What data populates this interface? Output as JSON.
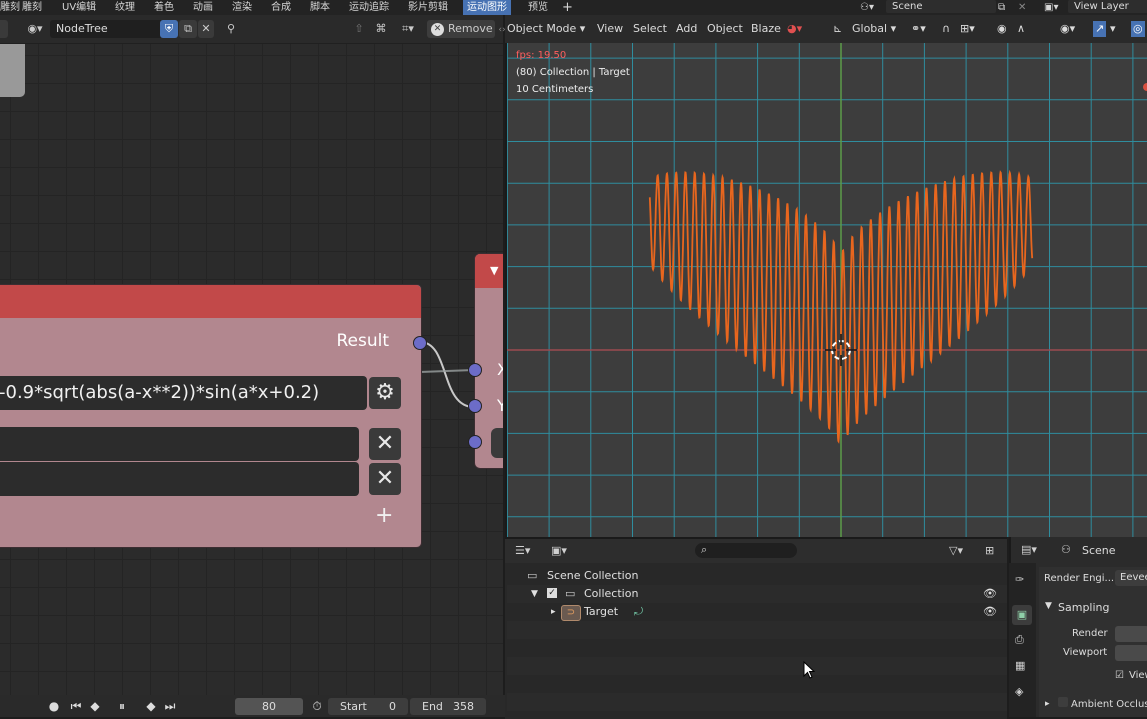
{
  "topbar": {
    "menus": [
      "雕刻",
      "UV编辑",
      "纹理",
      "着色",
      "动画",
      "渲染",
      "合成",
      "脚本",
      "运动追踪",
      "影片剪辑",
      "运动图形",
      "预览"
    ],
    "active_menu": "运动图形",
    "scene_name": "Scene",
    "view_layer": "View Layer"
  },
  "node_editor": {
    "tree_name": "NodeTree",
    "remove_label": "Remove",
    "result_label": "Result",
    "expression": "-0.9*sqrt(abs(a-x**2))*sin(a*x+0.2)",
    "socket_x": "X",
    "socket_y": "Y"
  },
  "timeline": {
    "frame": "80",
    "start_label": "Start",
    "start_value": "0",
    "end_label": "End",
    "end_value": "358"
  },
  "viewport": {
    "mode": "Object Mode",
    "menus": [
      "View",
      "Select",
      "Add",
      "Object",
      "Blaze"
    ],
    "orientation": "Global",
    "fps": "fps: 19.50",
    "collection_info": "(80) Collection | Target",
    "scale_info": "10 Centimeters",
    "curve_color": "#e8661e",
    "grid_color": "#2f8d9e"
  },
  "outliner": {
    "scene_collection": "Scene Collection",
    "collection": "Collection",
    "target": "Target"
  },
  "properties": {
    "scene_label": "Scene",
    "render_engine_label": "Render Engi...",
    "render_engine_value": "Eevee",
    "sampling_label": "Sampling",
    "render_label": "Render",
    "viewport_label": "Viewport",
    "view_label": "View",
    "ambient_label": "Ambient Occlusi..."
  }
}
